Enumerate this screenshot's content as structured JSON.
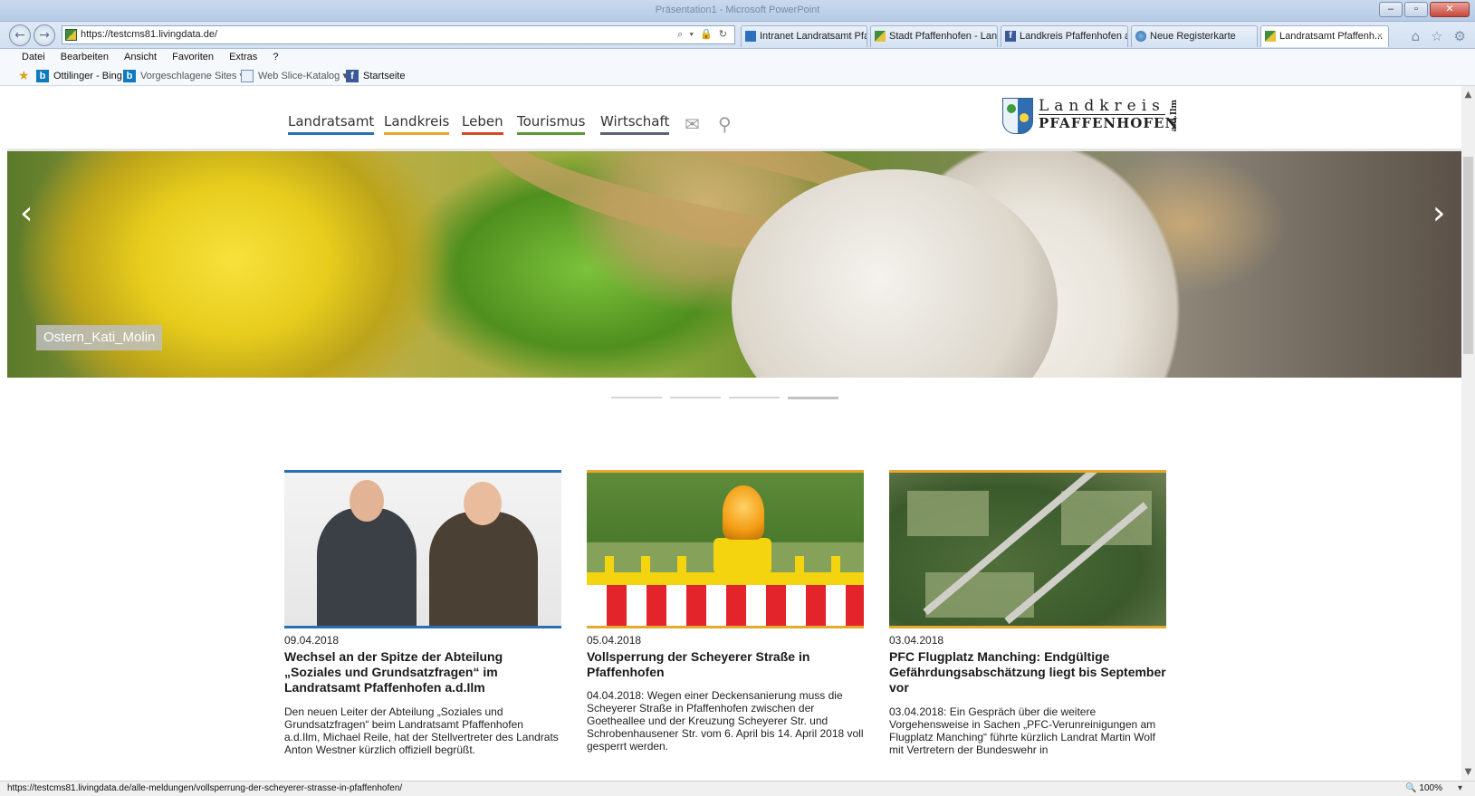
{
  "browser": {
    "address_url": "https://testcms81.livingdata.de/",
    "window_title": "Präsentation1 - Microsoft PowerPoint",
    "back_icon": "back-arrow-icon",
    "forward_icon": "forward-arrow-icon",
    "address_tools": "⌕ ▾ 🔒 ↻",
    "tabs": [
      {
        "label": "Intranet Landratsamt Pfaf...",
        "icon": "intranet-favicon",
        "active": false
      },
      {
        "label": "Stadt Pfaffenhofen - Lan...",
        "icon": "stadt-favicon",
        "active": false
      },
      {
        "label": "Landkreis Pfaffenhofen a...",
        "icon": "facebook-favicon",
        "active": false
      },
      {
        "label": "Neue Registerkarte",
        "icon": "ie-favicon",
        "active": false
      },
      {
        "label": "Landratsamt Pfaffenh...",
        "icon": "landkreis-favicon",
        "active": true
      }
    ],
    "tab_close": "×",
    "home_icon": "⌂",
    "favorites_icon": "☆",
    "settings_icon": "⚙",
    "menu": [
      "Datei",
      "Bearbeiten",
      "Ansicht",
      "Favoriten",
      "Extras",
      "?"
    ],
    "favorites_bar": {
      "items": [
        {
          "label": "Ottilinger - Bing",
          "icon": "bing-icon",
          "dropdown": false
        },
        {
          "label": "Vorgeschlagene Sites",
          "icon": "bing-icon",
          "dropdown": true
        },
        {
          "label": "Web Slice-Katalog",
          "icon": "web-slice-icon",
          "dropdown": true
        },
        {
          "label": "Startseite",
          "icon": "facebook-icon",
          "dropdown": false
        }
      ]
    },
    "status_url": "https://testcms81.livingdata.de/alle-meldungen/vollsperrung-der-scheyerer-strasse-in-pfaffenhofen/",
    "zoom": "100%"
  },
  "site": {
    "nav": [
      {
        "label": "Landratsamt",
        "color": "#2a6fb5"
      },
      {
        "label": "Landkreis",
        "color": "#e7a82f"
      },
      {
        "label": "Leben",
        "color": "#d24b2b"
      },
      {
        "label": "Tourismus",
        "color": "#5a9a34"
      },
      {
        "label": "Wirtschaft",
        "color": "#5a6472"
      }
    ],
    "mail_icon": "✉",
    "search_icon": "⚲",
    "logo": {
      "line1": "Landkreis",
      "line2": "PFAFFENHOFEN",
      "suffix": "a.d.Ilm"
    },
    "slider": {
      "caption": "Ostern_Kati_Molin",
      "prev": "‹",
      "next": "›",
      "slide_count": 4,
      "active_slide": 4
    },
    "news": [
      {
        "date": "09.04.2018",
        "title": "Wechsel an der Spitze der Abteilung „Soziales und Grundsatzfragen“ im Landratsamt Pfaffenhofen a.d.Ilm",
        "teaser": "Den neuen Leiter der Abteilung „Soziales und Grundsatzfragen“ beim Landratsamt Pfaffenhofen a.d.Ilm, Michael Reile, hat der Stellvertreter des Landrats Anton Westner kürzlich offiziell begrüßt.",
        "accent": "#2a6fb5"
      },
      {
        "date": "05.04.2018",
        "title": "Vollsperrung der Scheyerer Straße in Pfaffenhofen",
        "teaser": "04.04.2018: Wegen einer Deckensanierung muss die Scheyerer Straße in Pfaffenhofen zwischen der Goetheallee und der Kreuzung Scheyerer Str. und Schrobenhausener Str. vom 6. April bis 14. April 2018 voll gesperrt werden.",
        "accent": "#e7a82f"
      },
      {
        "date": "03.04.2018",
        "title": "PFC Flugplatz Manching: Endgültige Gefährdungsabschätzung liegt bis September vor",
        "teaser": "03.04.2018: Ein Gespräch über die weitere Vorgehensweise in Sachen „PFC-Verunreinigungen am Flugplatz Manching“ führte kürzlich Landrat Martin Wolf mit Vertretern der Bundeswehr in",
        "accent": "#e7a82f"
      }
    ]
  }
}
